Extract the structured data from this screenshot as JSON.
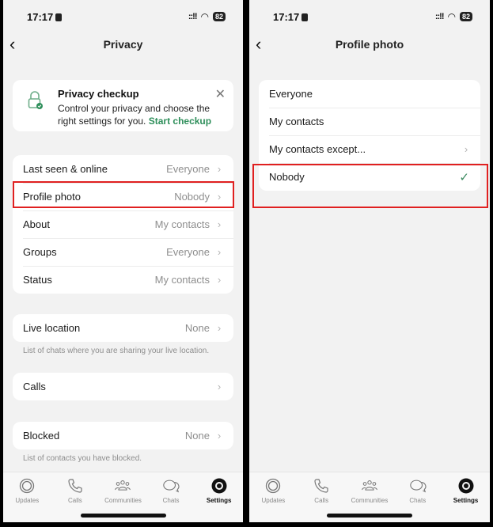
{
  "left": {
    "status": {
      "time": "17:17",
      "signal": "::!!",
      "battery": "82"
    },
    "title": "Privacy",
    "checkup": {
      "title": "Privacy checkup",
      "description": "Control your privacy and choose the right settings for you.",
      "link": "Start checkup"
    },
    "group1": [
      {
        "label": "Last seen & online",
        "value": "Everyone"
      },
      {
        "label": "Profile photo",
        "value": "Nobody"
      },
      {
        "label": "About",
        "value": "My contacts"
      },
      {
        "label": "Groups",
        "value": "Everyone"
      },
      {
        "label": "Status",
        "value": "My contacts"
      }
    ],
    "live_location": {
      "label": "Live location",
      "value": "None",
      "note": "List of chats where you are sharing your live location."
    },
    "calls": {
      "label": "Calls"
    },
    "blocked": {
      "label": "Blocked",
      "value": "None",
      "note": "List of contacts you have blocked."
    }
  },
  "right": {
    "status": {
      "time": "17:17",
      "signal": "::!!",
      "battery": "82"
    },
    "title": "Profile photo",
    "options": [
      {
        "label": "Everyone"
      },
      {
        "label": "My contacts"
      },
      {
        "label": "My contacts except..."
      },
      {
        "label": "Nobody",
        "selected": true
      }
    ]
  },
  "tabbar": {
    "items": [
      {
        "label": "Updates",
        "icon": "updates-icon"
      },
      {
        "label": "Calls",
        "icon": "phone-icon"
      },
      {
        "label": "Communities",
        "icon": "communities-icon"
      },
      {
        "label": "Chats",
        "icon": "chats-icon"
      },
      {
        "label": "Settings",
        "icon": "settings-gear-icon",
        "active": true
      }
    ]
  },
  "colors": {
    "accent": "#2f8f5b",
    "highlight": "#e02020"
  }
}
